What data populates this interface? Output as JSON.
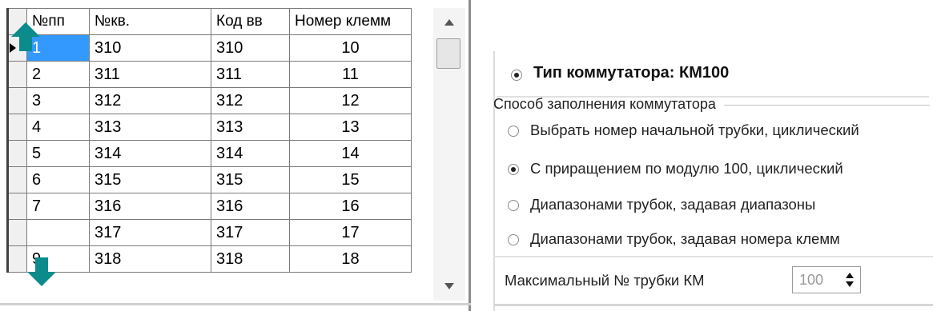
{
  "grid": {
    "columns": [
      "№пп",
      "№кв.",
      "Код вв",
      "Номер клемм"
    ],
    "rows": [
      [
        "1",
        "310",
        "310",
        "10"
      ],
      [
        "2",
        "311",
        "311",
        "11"
      ],
      [
        "3",
        "312",
        "312",
        "12"
      ],
      [
        "4",
        "313",
        "313",
        "13"
      ],
      [
        "5",
        "314",
        "314",
        "14"
      ],
      [
        "6",
        "315",
        "315",
        "15"
      ],
      [
        "7",
        "316",
        "316",
        "16"
      ],
      [
        "",
        "317",
        "317",
        "17"
      ],
      [
        "9",
        "318",
        "318",
        "18"
      ]
    ],
    "selected_row": 0,
    "selected_cell_color": "#3399ff",
    "arrow_color": "#0b8b8b",
    "arrow_up_icon": "arrow-up-icon",
    "arrow_down_icon": "arrow-down-icon"
  },
  "panel": {
    "type_label": "Тип коммутатора: КМ100",
    "group_title": "Способ заполнения коммутатора",
    "options": [
      {
        "label": "Выбрать номер начальной трубки, циклический",
        "checked": false
      },
      {
        "label": "С приращением по модулю 100, циклический",
        "checked": true
      },
      {
        "label": "Диапазонами трубок, задавая диапазоны",
        "checked": false
      },
      {
        "label": "Диапазонами трубок, задавая номера клемм",
        "checked": false
      }
    ],
    "max_label": "Максимальный № трубки КМ",
    "max_value": "100"
  }
}
